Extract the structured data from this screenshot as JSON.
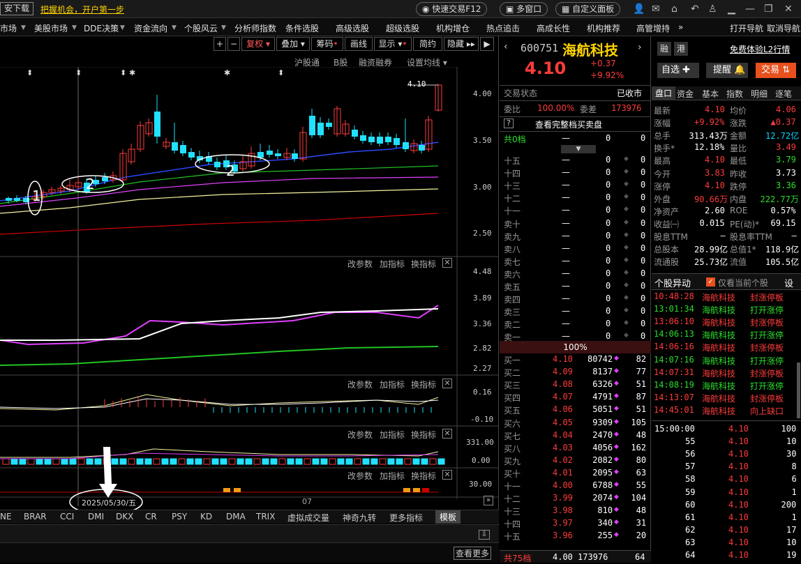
{
  "topbar": {
    "download": "安下载",
    "slogan": "把握机会，开户第一步",
    "quick_trade": "快速交易F12",
    "multi_window": "多窗口",
    "custom_panel": "自定义面板"
  },
  "menu": [
    "市场",
    "美股市场",
    "DDE决策",
    "资金流向",
    "个股风云",
    "分析师指数",
    "条件选股",
    "高级选股",
    "超级选股",
    "机构增仓",
    "热点追击",
    "高成长性",
    "机构推荐",
    "高管增持",
    "»",
    "打开导航",
    "取消导航"
  ],
  "toolbar": {
    "fuquan": "复权",
    "diejia": "叠加",
    "chouma": "筹码",
    "huaxian": "画线",
    "xianshi": "显示",
    "jianyue": "简约",
    "yincang": "隐藏"
  },
  "chart_tabs": {
    "hgt": "沪股通",
    "b": "B股",
    "rzrq": "融资融券",
    "settings": "设置均线"
  },
  "price_axis": [
    "4.00",
    "3.50",
    "3.00",
    "2.50"
  ],
  "last_price_label": "4.10",
  "indicator_axis": [
    "4.48",
    "3.89",
    "3.36",
    "2.82",
    "2.27"
  ],
  "macd_axis": [
    "0.16",
    "-0.10"
  ],
  "vol_axis": [
    "331.00",
    "0.00"
  ],
  "last_axis": "30.00",
  "panel_btns": {
    "gai": "改参数",
    "add": "加指标",
    "swap": "换指标"
  },
  "annotations": {
    "one": "1",
    "two": "2"
  },
  "date_label": "2025/05/30/五",
  "month_label": "07",
  "indicator_tabs": [
    "NE",
    "BRAR",
    "CCI",
    "DMI",
    "DKX",
    "CR",
    "PSY",
    "KD",
    "DMA",
    "TRIX",
    "虚拟成交量",
    "神奇九转",
    "更多指标",
    "模板"
  ],
  "more": "查看更多",
  "stock": {
    "code": "600751",
    "name": "海航科技",
    "price": "4.10",
    "change": "+0.37",
    "pct": "+9.92%",
    "rong": "融",
    "gang": "港",
    "l2": "免费体验L2行情",
    "zixuan": "自选",
    "tixing": "提醒",
    "jiaoyi": "交易"
  },
  "trade_status": {
    "label": "交易状态",
    "value": "已收市"
  },
  "weibi": {
    "label": "委比",
    "value": "100.00%",
    "cha_label": "委差",
    "cha": "173976"
  },
  "view_full": "查看完整档买卖盘",
  "q_mark": "?",
  "total0": "共0档",
  "sells": [
    [
      "十五",
      "—",
      "0",
      "0"
    ],
    [
      "十四",
      "—",
      "0",
      "0"
    ],
    [
      "十三",
      "—",
      "0",
      "0"
    ],
    [
      "十二",
      "—",
      "0",
      "0"
    ],
    [
      "十一",
      "—",
      "0",
      "0"
    ],
    [
      "卖十",
      "—",
      "0",
      "0"
    ],
    [
      "卖九",
      "—",
      "0",
      "0"
    ],
    [
      "卖八",
      "—",
      "0",
      "0"
    ],
    [
      "卖七",
      "—",
      "0",
      "0"
    ],
    [
      "卖六",
      "—",
      "0",
      "0"
    ],
    [
      "卖五",
      "—",
      "0",
      "0"
    ],
    [
      "卖四",
      "—",
      "0",
      "0"
    ],
    [
      "卖三",
      "—",
      "0",
      "0"
    ],
    [
      "卖二",
      "—",
      "0",
      "0"
    ],
    [
      "卖一",
      "—",
      "0",
      "0"
    ]
  ],
  "pct100": "100%",
  "buys": [
    [
      "买一",
      "4.10",
      "80742",
      "82"
    ],
    [
      "买二",
      "4.09",
      "8137",
      "77"
    ],
    [
      "买三",
      "4.08",
      "6326",
      "51"
    ],
    [
      "买四",
      "4.07",
      "4791",
      "87"
    ],
    [
      "买五",
      "4.06",
      "5051",
      "51"
    ],
    [
      "买六",
      "4.05",
      "9309",
      "105"
    ],
    [
      "买七",
      "4.04",
      "2470",
      "48"
    ],
    [
      "买八",
      "4.03",
      "4056",
      "162"
    ],
    [
      "买九",
      "4.02",
      "2082",
      "80"
    ],
    [
      "买十",
      "4.01",
      "2095",
      "63"
    ],
    [
      "十一",
      "4.00",
      "6788",
      "55"
    ],
    [
      "十二",
      "3.99",
      "2074",
      "104"
    ],
    [
      "十三",
      "3.98",
      "810",
      "48"
    ],
    [
      "十四",
      "3.97",
      "340",
      "31"
    ],
    [
      "十五",
      "3.96",
      "255",
      "20"
    ]
  ],
  "total75": [
    "共75档",
    "4.00",
    "173976",
    "64"
  ],
  "stat_tabs": [
    "盘口",
    "资金",
    "基本",
    "指数",
    "明细",
    "逐笔"
  ],
  "stats": [
    [
      "最新",
      "4.10",
      "均价",
      "4.06"
    ],
    [
      "涨幅",
      "+9.92%",
      "涨跌",
      "▲0.37"
    ],
    [
      "总手",
      "313.43万",
      "金额",
      "12.72亿"
    ],
    [
      "换手*",
      "12.18%",
      "量比",
      "3.49"
    ],
    [
      "最高",
      "4.10",
      "最低",
      "3.79"
    ],
    [
      "今开",
      "3.83",
      "昨收",
      "3.73"
    ],
    [
      "涨停",
      "4.10",
      "跌停",
      "3.36"
    ],
    [
      "外盘",
      "90.66万",
      "内盘",
      "222.77万"
    ],
    [
      "净资产",
      "2.60",
      "ROE",
      "0.57%"
    ],
    [
      "收益㈠",
      "0.015",
      "PE(动)*",
      "69.15"
    ],
    [
      "股息TTM",
      "—",
      "股息率TTM",
      "—"
    ],
    [
      "总股本",
      "28.99亿",
      "总值1*",
      "118.9亿"
    ],
    [
      "流通股",
      "25.73亿",
      "流值",
      "105.5亿"
    ]
  ],
  "yidong": {
    "title": "个股异动",
    "check": "仅看当前个股",
    "btn": "设"
  },
  "events": [
    [
      "10:48:28",
      "海航科技",
      "封涨停板",
      "red"
    ],
    [
      "13:01:34",
      "海航科技",
      "打开涨停",
      "green"
    ],
    [
      "13:06:10",
      "海航科技",
      "封涨停板",
      "red"
    ],
    [
      "14:06:13",
      "海航科技",
      "打开涨停",
      "green"
    ],
    [
      "14:06:16",
      "海航科技",
      "封涨停板",
      "red"
    ],
    [
      "14:07:16",
      "海航科技",
      "打开涨停",
      "green"
    ],
    [
      "14:07:31",
      "海航科技",
      "封涨停板",
      "red"
    ],
    [
      "14:08:19",
      "海航科技",
      "打开涨停",
      "green"
    ],
    [
      "14:13:07",
      "海航科技",
      "封涨停板",
      "red"
    ],
    [
      "14:45:01",
      "海航科技",
      "向上缺口",
      "red"
    ]
  ],
  "ticks": [
    [
      "15:00:00",
      "4.10",
      "100"
    ],
    [
      "55",
      "4.10",
      "10"
    ],
    [
      "56",
      "4.10",
      "30"
    ],
    [
      "57",
      "4.10",
      "8"
    ],
    [
      "58",
      "4.10",
      "6"
    ],
    [
      "59",
      "4.10",
      "1"
    ],
    [
      "60",
      "4.10",
      "200"
    ],
    [
      "61",
      "4.10",
      "1"
    ],
    [
      "62",
      "4.10",
      "17"
    ],
    [
      "63",
      "4.10",
      "10"
    ],
    [
      "64",
      "4.10",
      "19"
    ]
  ]
}
